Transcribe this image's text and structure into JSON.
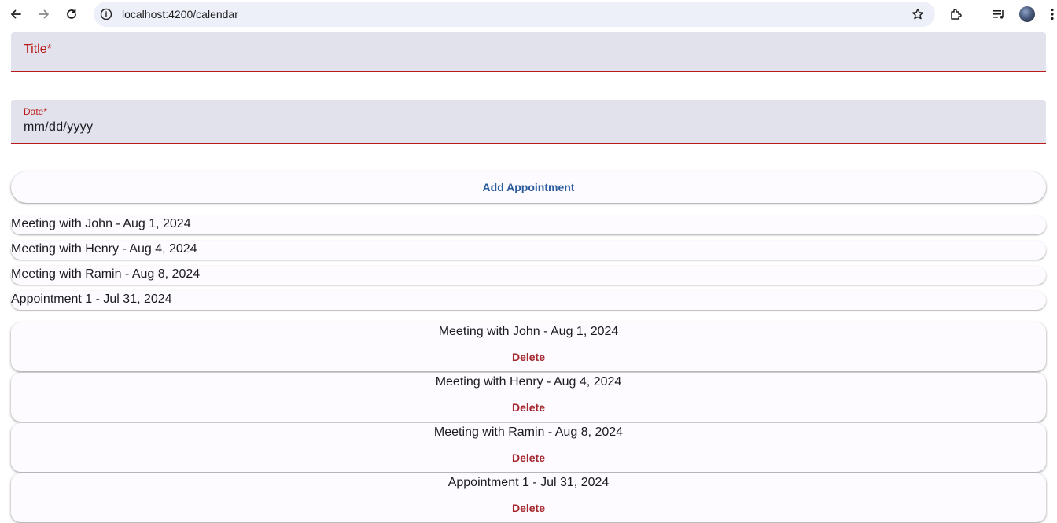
{
  "browser": {
    "url": "localhost:4200/calendar",
    "icons": [
      "back-arrow-icon",
      "forward-arrow-icon",
      "reload-icon",
      "site-info-icon",
      "bookmark-star-icon",
      "extensions-icon",
      "media-queue-icon",
      "profile-avatar",
      "more-menu-icon"
    ]
  },
  "form": {
    "title_label": "Title*",
    "date_label": "Date*",
    "date_placeholder": "mm/dd/yyyy",
    "add_button": "Add Appointment",
    "error_color": "#ba1a1a",
    "accent_color": "#2a5b9d"
  },
  "chips": [
    {
      "label": "Meeting with John - Aug 1, 2024"
    },
    {
      "label": "Meeting with Henry - Aug 4, 2024"
    },
    {
      "label": "Meeting with Ramin - Aug 8, 2024"
    },
    {
      "label": "Appointment 1 - Jul 31, 2024"
    }
  ],
  "cards": [
    {
      "title": "Meeting with John - Aug 1, 2024",
      "delete_label": "Delete"
    },
    {
      "title": "Meeting with Henry - Aug 4, 2024",
      "delete_label": "Delete"
    },
    {
      "title": "Meeting with Ramin - Aug 8, 2024",
      "delete_label": "Delete"
    },
    {
      "title": "Appointment 1 - Jul 31, 2024",
      "delete_label": "Delete"
    }
  ]
}
